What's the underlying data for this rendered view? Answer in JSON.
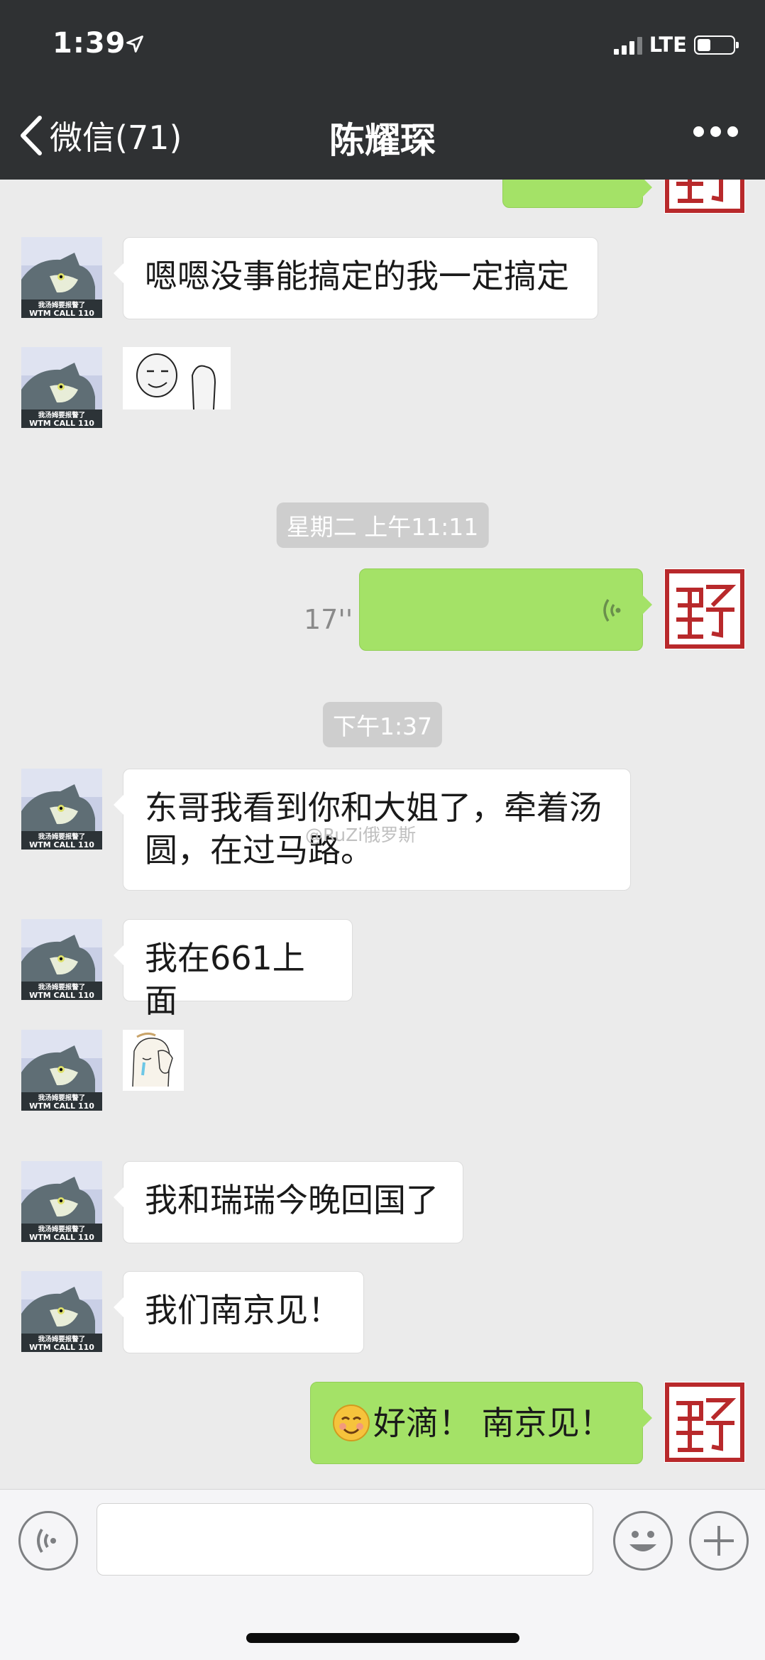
{
  "status_bar": {
    "time": "1:39",
    "network": "LTE"
  },
  "header": {
    "back_label": "微信(71)",
    "title": "陈耀琛"
  },
  "avatar_caption": {
    "line1": "我汤姆要报警了",
    "line2": "WTM CALL 110"
  },
  "timestamps": {
    "t1": "星期二 上午11:11",
    "t2": "下午1:37"
  },
  "voice_message": {
    "duration": "17''"
  },
  "messages": {
    "m1": "嗯嗯没事能搞定的我一定搞定",
    "m2_line1": "东哥我看到你和大姐了，牵着汤",
    "m2_line2": "圆，在过马路。",
    "m3": "我在661上面",
    "m4": "我和瑞瑞今晚回国了",
    "m5": "我们南京见！",
    "reply": "好滴！ 南京见！"
  },
  "watermark": "@RuZi俄罗斯",
  "colors": {
    "header_bg": "#2f3133",
    "chat_bg": "#ebebeb",
    "sent_bubble": "#a4e267",
    "received_bubble": "#ffffff",
    "seal_red": "#b8292b"
  }
}
